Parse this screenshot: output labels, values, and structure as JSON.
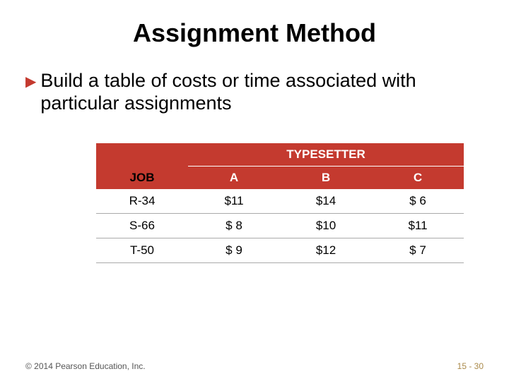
{
  "title": "Assignment Method",
  "bullet": "Build a table of costs or time associated with particular assignments",
  "table": {
    "group_header": "TYPESETTER",
    "job_header": "JOB",
    "columns": [
      "A",
      "B",
      "C"
    ],
    "rows": [
      {
        "job": "R-34",
        "a": "$11",
        "b": "$14",
        "c": "$  6"
      },
      {
        "job": "S-66",
        "a": "$  8",
        "b": "$10",
        "c": "$11"
      },
      {
        "job": "T-50",
        "a": "$  9",
        "b": "$12",
        "c": "$  7"
      }
    ]
  },
  "footer": {
    "copyright": "© 2014 Pearson Education, Inc.",
    "pagenum": "15 - 30"
  },
  "chart_data": {
    "type": "table",
    "title": "Assignment Method cost table",
    "columns": [
      "JOB",
      "A",
      "B",
      "C"
    ],
    "rows": [
      [
        "R-34",
        11,
        14,
        6
      ],
      [
        "S-66",
        8,
        10,
        11
      ],
      [
        "T-50",
        9,
        12,
        7
      ]
    ],
    "group_header": "TYPESETTER",
    "units": "USD"
  }
}
